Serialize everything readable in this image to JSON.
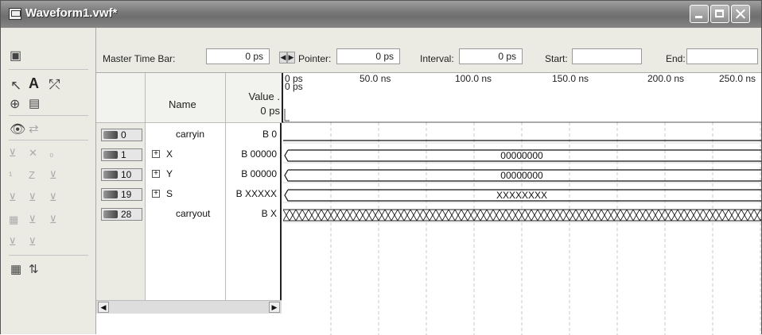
{
  "window": {
    "title": "Waveform1.vwf*"
  },
  "master_bar": {
    "master_label": "Master Time Bar:",
    "master_value": "0 ps",
    "pointer_label": "Pointer:",
    "pointer_value": "0 ps",
    "interval_label": "Interval:",
    "interval_value": "0 ps",
    "start_label": "Start:",
    "start_value": "",
    "end_label": "End:",
    "end_value": ""
  },
  "columns": {
    "name": "Name",
    "value": "Value .",
    "value_time": "0 ps"
  },
  "timeline": {
    "cursor_label": "0 ps",
    "ticks": [
      "0 ps",
      "50.0 ns",
      "100.0 ns",
      "150.0 ns",
      "200.0 ns",
      "250.0 ns"
    ]
  },
  "signals": [
    {
      "pin": "0",
      "name": "carryin",
      "value": "B 0",
      "expandable": false,
      "wave_text": ""
    },
    {
      "pin": "1",
      "name": "X",
      "value": "B 00000",
      "expandable": true,
      "wave_text": "00000000"
    },
    {
      "pin": "10",
      "name": "Y",
      "value": "B 00000",
      "expandable": true,
      "wave_text": "00000000"
    },
    {
      "pin": "19",
      "name": "S",
      "value": "B XXXXX",
      "expandable": true,
      "wave_text": "XXXXXXXX"
    },
    {
      "pin": "28",
      "name": "carryout",
      "value": "B X",
      "expandable": false,
      "wave_text": ""
    }
  ],
  "icons": {
    "title": "window-icon",
    "tools": [
      "selection-tool-icon",
      "text-tool-icon",
      "waveform-editing-tool-icon",
      "zoom-tool-icon",
      "full-screen-icon",
      "find-icon",
      "replace-icon"
    ]
  }
}
